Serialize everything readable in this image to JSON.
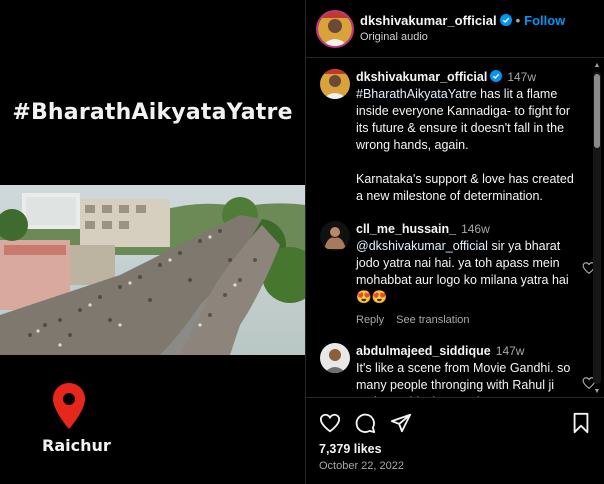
{
  "media": {
    "hashtag_banner": "#BharathAikyataYatre",
    "place": "Raichur"
  },
  "header": {
    "username": "dkshivakumar_official",
    "follow_label": "Follow",
    "dot": "•",
    "audio": "Original audio"
  },
  "comments": [
    {
      "username": "dkshivakumar_official",
      "time": "147w",
      "hashtag": "#BharathAikyataYatre",
      "text": " has lit a flame inside everyone Kannadiga- to fight for its future & ensure it doesn't fall in the wrong hands, again.",
      "text2": "Karnataka's support & love has created a new milestone of determination."
    },
    {
      "username": "cll_me_hussain_",
      "time": "146w",
      "mention": "@dkshivakumar_official",
      "text": " sir ya bharat jodo yatra nai hai. ya toh apass mein mohabbat aur logo ko milana yatra hai 😍😍",
      "reply_label": "Reply",
      "translation_label": "See translation"
    },
    {
      "username": "abdulmajeed_siddique",
      "time": "147w",
      "text": "It's like a scene from Movie Gandhi. so many people thronging with Rahul ji and DK Shivakumar sir"
    }
  ],
  "actions": {
    "likes": "7,379 likes",
    "date": "October 22, 2022"
  },
  "icons": {
    "verified": "verified-badge-icon",
    "like": "heart-icon",
    "comment": "comment-icon",
    "share": "paper-plane-icon",
    "save": "bookmark-icon",
    "location": "map-pin-icon"
  },
  "colors": {
    "background": "#000000",
    "accent_blue": "#0095f6",
    "verified_blue": "#0095f6",
    "pin_red": "#e8271c",
    "secondary_text": "#a8a8a8",
    "divider": "#262626"
  }
}
